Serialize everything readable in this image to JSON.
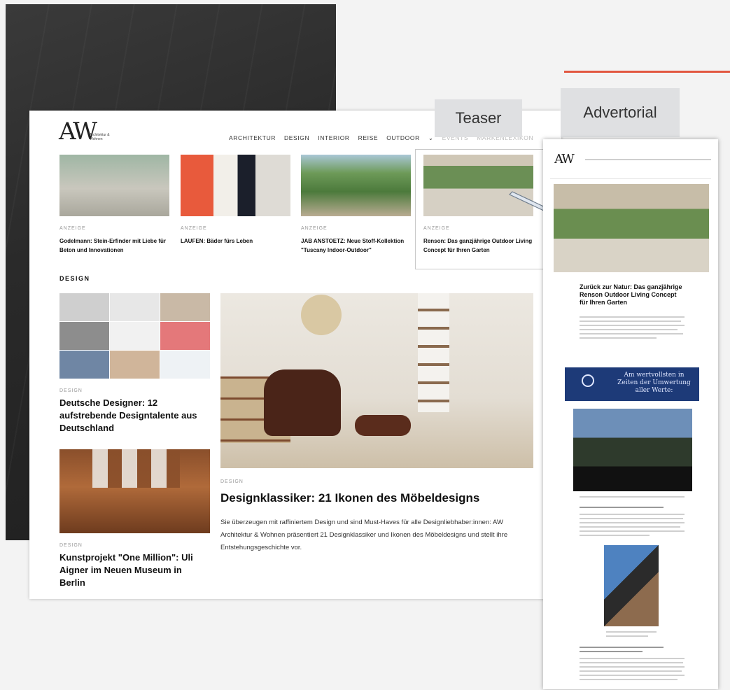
{
  "site": {
    "logo": "AW",
    "logo_sub": "Architektur & Wohnen",
    "nav": [
      "ARCHITEKTUR",
      "DESIGN",
      "INTERIOR",
      "REISE",
      "OUTDOOR",
      "EVENTS",
      "MARKENLEXIKON"
    ]
  },
  "teasers": [
    {
      "kicker": "ANZEIGE",
      "title": "Godelmann: Stein-Erfinder mit Liebe für Beton und Innovationen"
    },
    {
      "kicker": "ANZEIGE",
      "title": "LAUFEN: Bäder fürs Leben"
    },
    {
      "kicker": "ANZEIGE",
      "title": "JAB ANSTOETZ: Neue Stoff-Kollektion \"Tuscany Indoor-Outdoor\""
    },
    {
      "kicker": "ANZEIGE",
      "title": "Renson: Das ganzjährige Outdoor Living Concept für Ihren Garten"
    }
  ],
  "section_title": "DESIGN",
  "articles": {
    "a1": {
      "kicker": "DESIGN",
      "title": "Deutsche Designer: 12 aufstrebende Designtalente aus Deutschland"
    },
    "a2": {
      "kicker": "DESIGN",
      "title": "Kunstprojekt \"One Million\": Uli Aigner im Neuen Museum in Berlin"
    },
    "main": {
      "kicker": "DESIGN",
      "title": "Designklassiker: 21 Ikonen des Möbeldesigns",
      "body": "Sie überzeugen mit raffiniertem Design und sind Must-Haves für alle Designliebhaber:innen: AW Architektur & Wohnen präsentiert 21 Designklassiker und Ikonen des Möbeldesigns und stellt ihre Entstehungsgeschichte vor."
    }
  },
  "labels": {
    "teaser": "Teaser",
    "advertorial": "Advertorial"
  },
  "advertorial": {
    "logo": "AW",
    "headline": "Zurück zur Natur: Das ganzjährige Renson Outdoor Living Concept für Ihren Garten",
    "banner": "Am wertvollsten in Zeiten der Umwertung aller Werte:"
  },
  "colors": {
    "accent_red": "#e2573f",
    "banner_blue": "#1d3a78"
  }
}
